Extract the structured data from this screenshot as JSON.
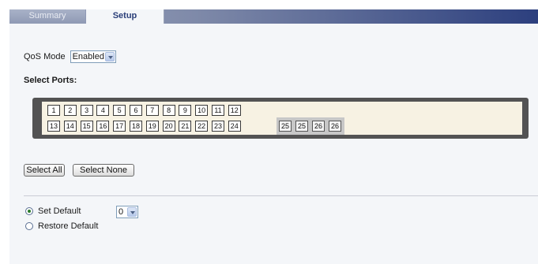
{
  "tabs": [
    {
      "label": "Summary",
      "active": false
    },
    {
      "label": "Setup",
      "active": true
    }
  ],
  "qos": {
    "label": "QoS Mode",
    "value": "Enabled"
  },
  "select_ports": {
    "label": "Select Ports:"
  },
  "ports": {
    "row1": [
      "1",
      "2",
      "3",
      "4",
      "5",
      "6",
      "7",
      "8",
      "9",
      "10",
      "11",
      "12"
    ],
    "row2": [
      "13",
      "14",
      "15",
      "16",
      "17",
      "18",
      "19",
      "20",
      "21",
      "22",
      "23",
      "24"
    ],
    "sfp": [
      "25",
      "25",
      "26",
      "26"
    ]
  },
  "buttons": {
    "select_all": "Select All",
    "select_none": "Select None"
  },
  "options": {
    "set_default": {
      "label": "Set Default",
      "checked": true,
      "value": "0"
    },
    "restore_default": {
      "label": "Restore Default",
      "checked": false
    }
  },
  "colors": {
    "tab_active_text": "#2a3f79",
    "panel_bg": "#f4f6f9",
    "port_frame": "#535353"
  }
}
